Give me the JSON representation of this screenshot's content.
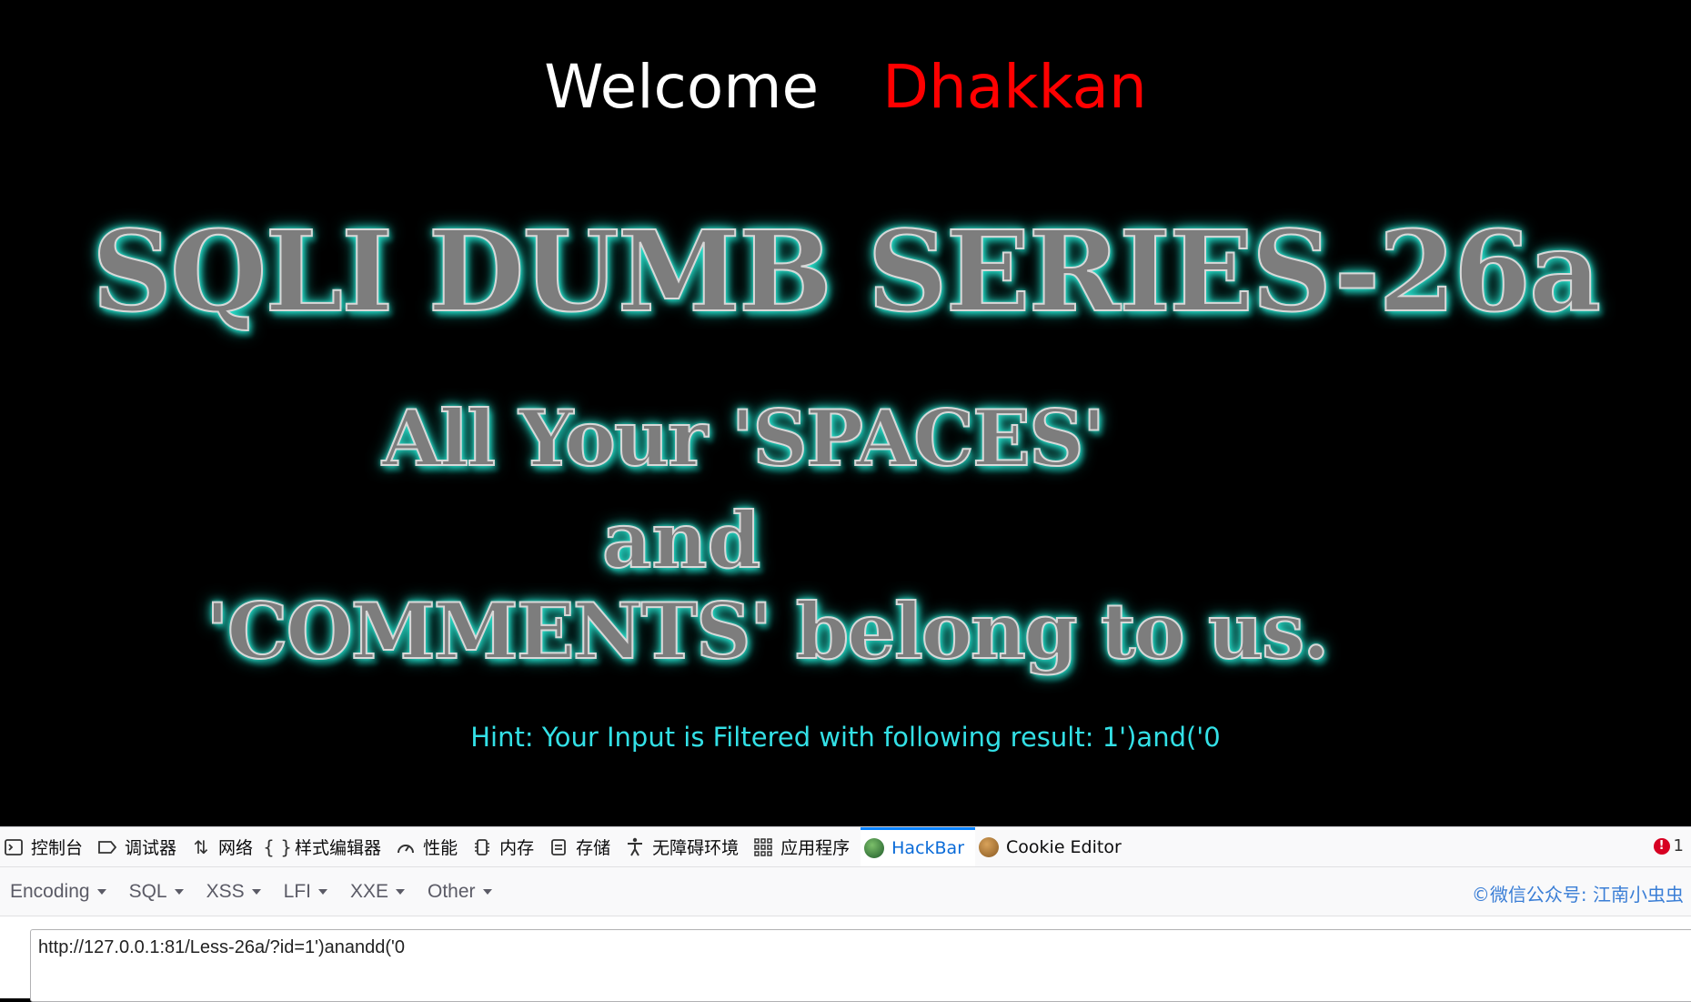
{
  "page": {
    "welcome_word": "Welcome",
    "user_name": "Dhakkan",
    "banner_title": "SQLI DUMB SERIES-26a",
    "slogan_line1": "All Your 'SPACES'",
    "slogan_line2": "and",
    "slogan_line3": "'COMMENTS' belong to us.",
    "hint": "Hint: Your Input is Filtered with following result: 1')and('0"
  },
  "devtools": {
    "tabs": [
      {
        "label": "控制台",
        "icon": "console-icon"
      },
      {
        "label": "调试器",
        "icon": "debugger-icon"
      },
      {
        "label": "网络",
        "icon": "network-icon"
      },
      {
        "label": "样式编辑器",
        "icon": "style-editor-icon"
      },
      {
        "label": "性能",
        "icon": "performance-icon"
      },
      {
        "label": "内存",
        "icon": "memory-icon"
      },
      {
        "label": "存储",
        "icon": "storage-icon"
      },
      {
        "label": "无障碍环境",
        "icon": "accessibility-icon"
      },
      {
        "label": "应用程序",
        "icon": "application-icon"
      },
      {
        "label": "HackBar",
        "icon": "hackbar-icon",
        "active": true
      },
      {
        "label": "Cookie Editor",
        "icon": "cookie-icon"
      }
    ],
    "error_count": "1"
  },
  "hackbar": {
    "menus": [
      "Encoding",
      "SQL",
      "XSS",
      "LFI",
      "XXE",
      "Other"
    ],
    "watermark": "©微信公众号: 江南小虫虫",
    "url_value": "http://127.0.0.1:81/Less-26a/?id=1')anandd('0"
  },
  "colors": {
    "background": "#000000",
    "welcome": "#ffffff",
    "user_name": "#ff0000",
    "hint": "#33e0e6",
    "glow": "#2fe6d2",
    "active_tab": "#0a6bd8"
  }
}
